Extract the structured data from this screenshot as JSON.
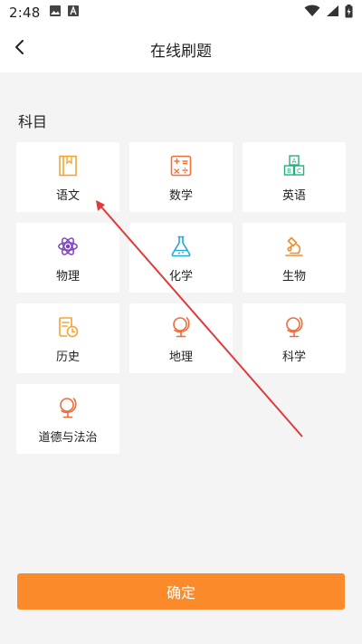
{
  "status_bar": {
    "time": "2:48",
    "icons": [
      "image-notification-icon",
      "a-notification-icon",
      "wifi-icon",
      "signal-icon",
      "battery-charging-icon"
    ]
  },
  "header": {
    "title": "在线刷题",
    "back_icon": "chevron-left-icon"
  },
  "section": {
    "title": "科目"
  },
  "subjects": [
    {
      "label": "语文",
      "icon": "book-icon",
      "color": "#f3a533"
    },
    {
      "label": "数学",
      "icon": "calculator-icon",
      "color": "#f26f3a"
    },
    {
      "label": "英语",
      "icon": "abc-blocks-icon",
      "color": "#24b07c"
    },
    {
      "label": "物理",
      "icon": "atom-icon",
      "color": "#7b3fbf"
    },
    {
      "label": "化学",
      "icon": "flask-icon",
      "color": "#22a9d3"
    },
    {
      "label": "生物",
      "icon": "microscope-icon",
      "color": "#f18d2e"
    },
    {
      "label": "历史",
      "icon": "history-doc-icon",
      "color": "#f3a533"
    },
    {
      "label": "地理",
      "icon": "globe-icon",
      "color": "#ef6b3a"
    },
    {
      "label": "科学",
      "icon": "globe-icon",
      "color": "#ef6b3a"
    },
    {
      "label": "道德与法治",
      "icon": "globe-icon",
      "color": "#ef6b3a"
    }
  ],
  "confirm": {
    "label": "确定",
    "color": "#fb8a2a"
  },
  "annotation": {
    "icon": "red-arrow-icon",
    "color": "#e03a3a"
  }
}
